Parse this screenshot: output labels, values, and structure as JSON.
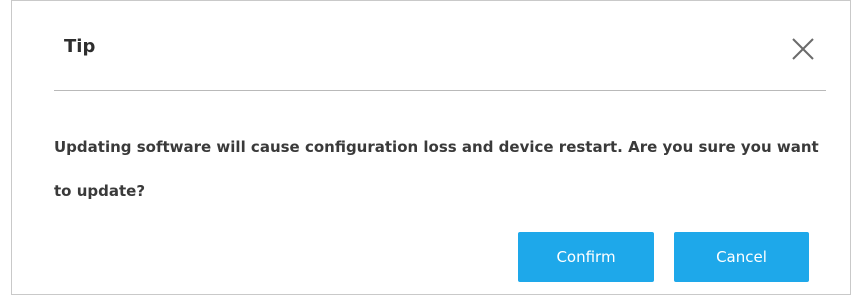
{
  "dialog": {
    "title": "Tip",
    "close_icon": "close-icon",
    "message": "Updating software will cause configuration loss and device restart. Are you sure you want to update?",
    "buttons": {
      "confirm_label": "Confirm",
      "cancel_label": "Cancel"
    },
    "colors": {
      "button_bg": "#1ea8ea",
      "button_text": "#ffffff",
      "border": "#c9c9c9",
      "divider": "#b9b9b9"
    }
  }
}
